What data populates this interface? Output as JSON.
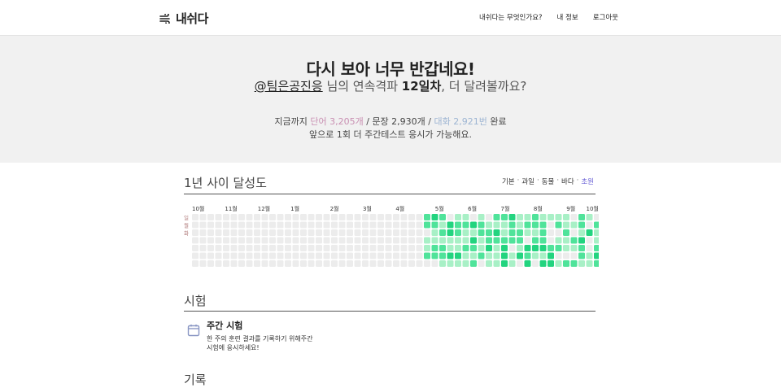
{
  "nav": {
    "logo_text": "내쉬다",
    "links": [
      "내쉬다는 무엇인가요?",
      "내 정보",
      "로그아웃"
    ]
  },
  "hero": {
    "title": "다시 보아 너무 반갑네요!",
    "username": "@팀은공진응",
    "sub_mid": " 님의 연속격파 ",
    "days": "12일차",
    "sub_end": ", 더 달려볼까요?",
    "stats_prefix": "지금까지 ",
    "words": "단어 3,205개",
    "sep1": " / ",
    "sentences": "문장 2,930개",
    "sep2": " / ",
    "conversations": "대화 2,921번",
    "stats_suffix": " 완료",
    "note": "앞으로 1회 더 주간테스트 응시가 가능해요."
  },
  "achievement": {
    "title": "1년 사이 달성도",
    "filters": [
      "기본",
      "과일",
      "동물",
      "바다",
      "초원"
    ],
    "active_filter": "초원",
    "months": [
      "10월",
      "11월",
      "12월",
      "1월",
      "2월",
      "3월",
      "4월",
      "5월",
      "6월",
      "7월",
      "8월",
      "9월",
      "10월"
    ],
    "day_labels": [
      "일",
      "월",
      "화"
    ],
    "colors": {
      "empty": "#ececec",
      "level1": "#a8f0c6",
      "level2": "#4fe39a",
      "level3": "#22d47f"
    }
  },
  "exam": {
    "section_title": "시험",
    "card_title": "주간 시험",
    "card_desc_line1": "한 주의 훈련 결과를 기록하기 위해주간",
    "card_desc_line2": "시험에 응시하세요!"
  },
  "next_section_title": "기록"
}
